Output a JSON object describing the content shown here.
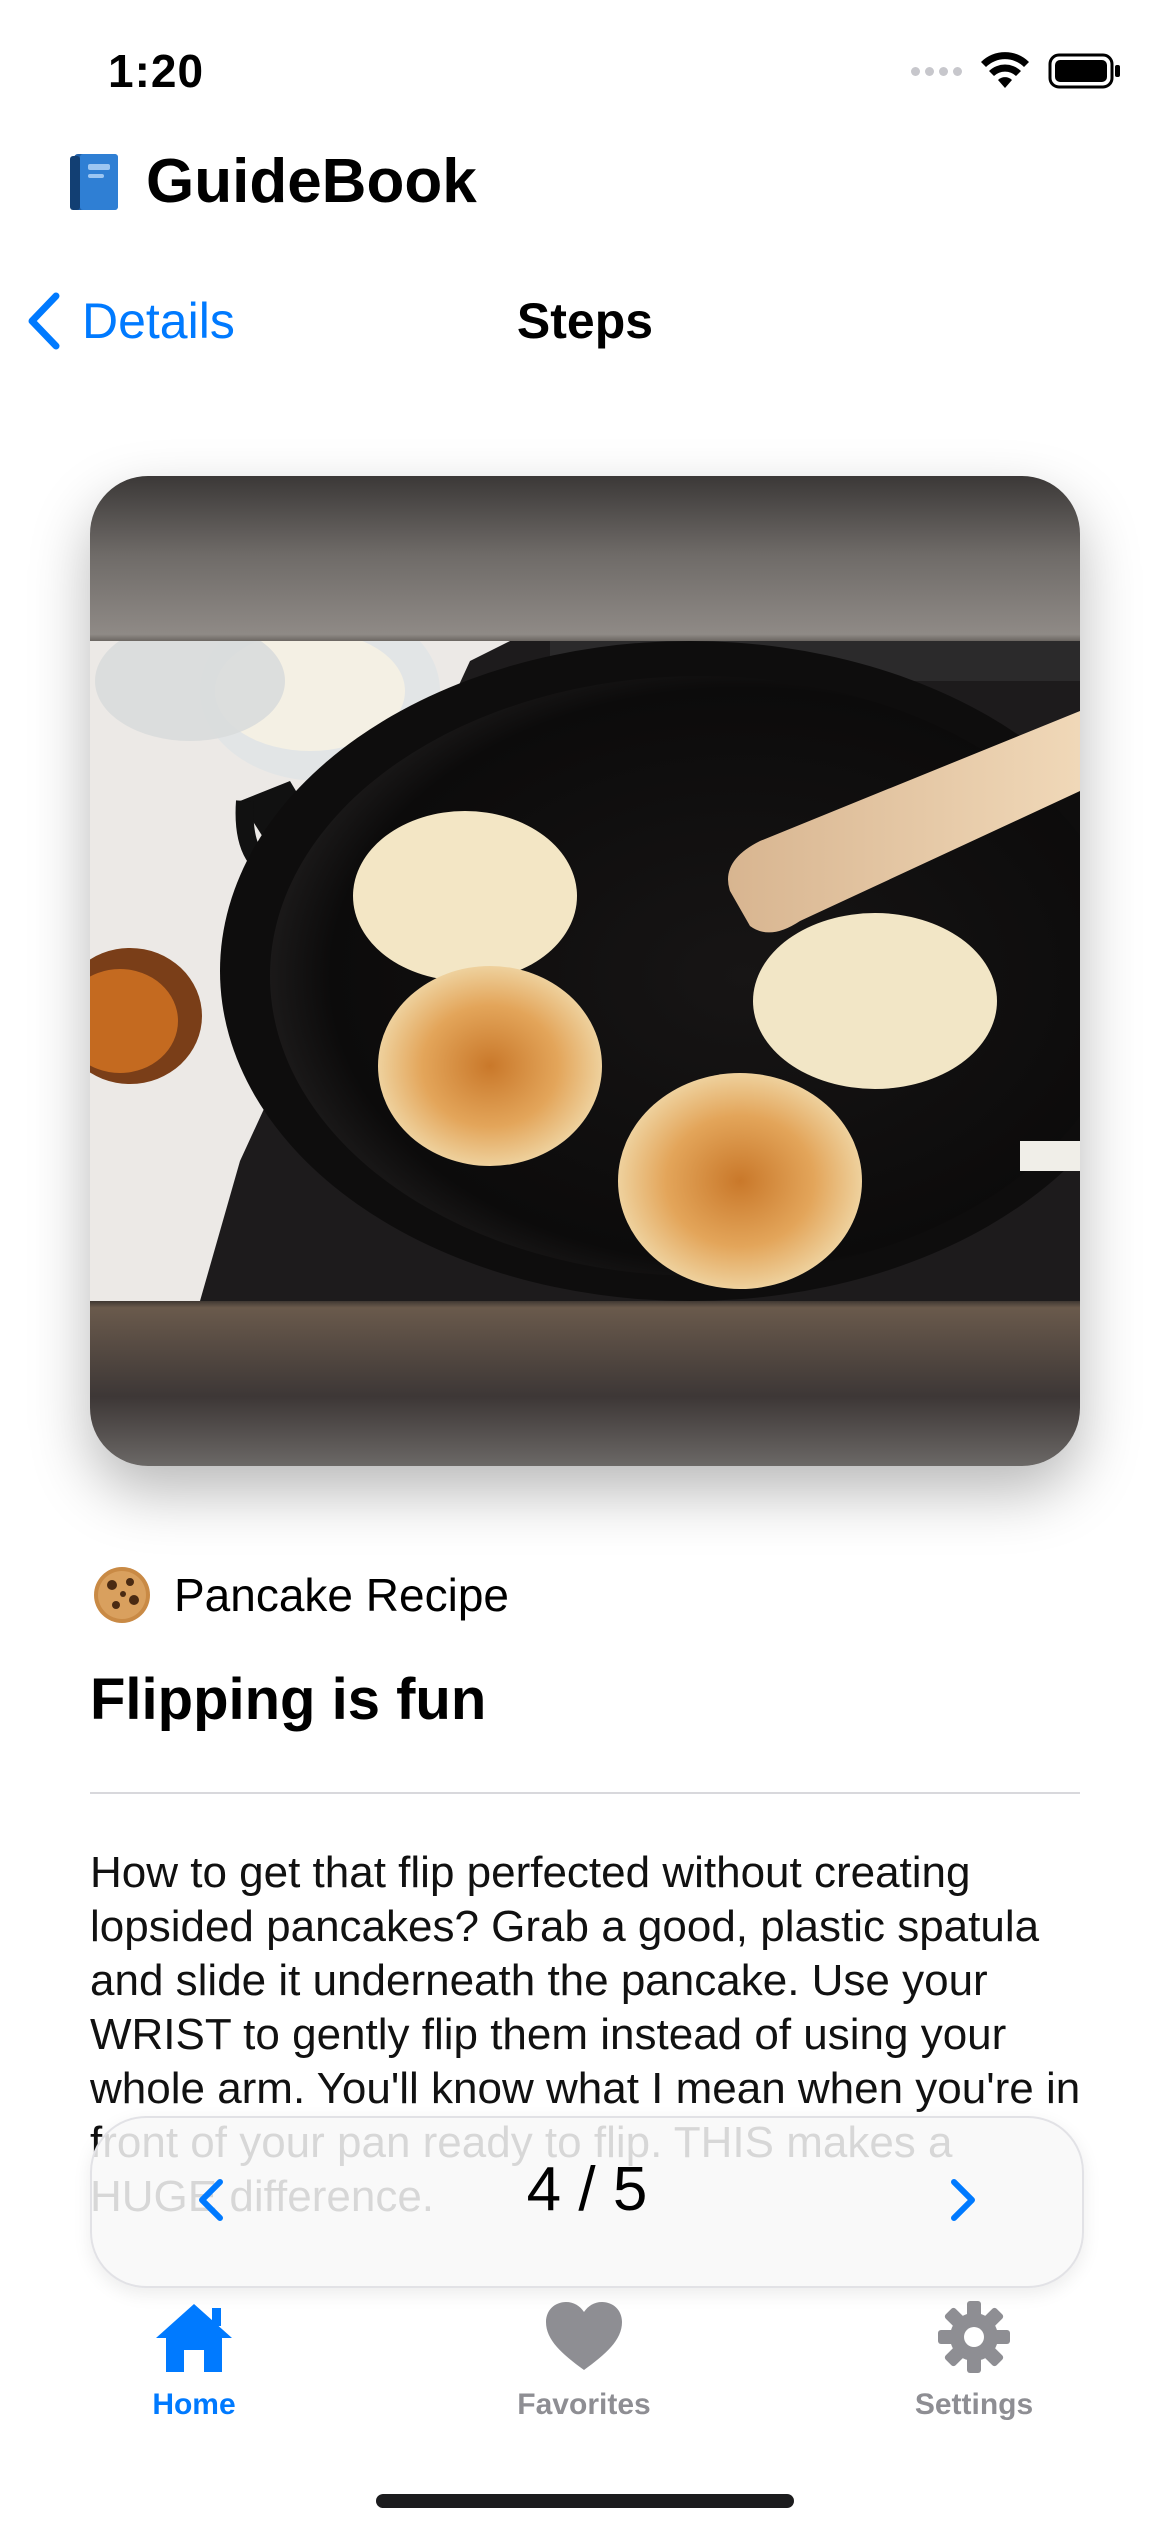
{
  "status_bar": {
    "time": "1:20"
  },
  "app": {
    "name": "GuideBook"
  },
  "nav": {
    "back_label": "Details",
    "title": "Steps"
  },
  "recipe": {
    "name": "Pancake Recipe"
  },
  "step": {
    "title": "Flipping is fun",
    "body": "How to get that flip perfected without creating lopsided pancakes? Grab a good, plastic spatula and slide it underneath the pancake. Use your WRIST to gently flip them instead of using your whole arm. You'll know what I mean when you're in front of your pan ready to flip. THIS makes a HUGE difference."
  },
  "pager": {
    "counter": "4 / 5"
  },
  "tabs": [
    {
      "label": "Home",
      "icon": "house-icon",
      "selected": true
    },
    {
      "label": "Favorites",
      "icon": "heart-icon",
      "selected": false
    },
    {
      "label": "Settings",
      "icon": "gear-icon",
      "selected": false
    }
  ],
  "colors": {
    "accent": "#007aff",
    "inactive": "#8e8e93"
  }
}
